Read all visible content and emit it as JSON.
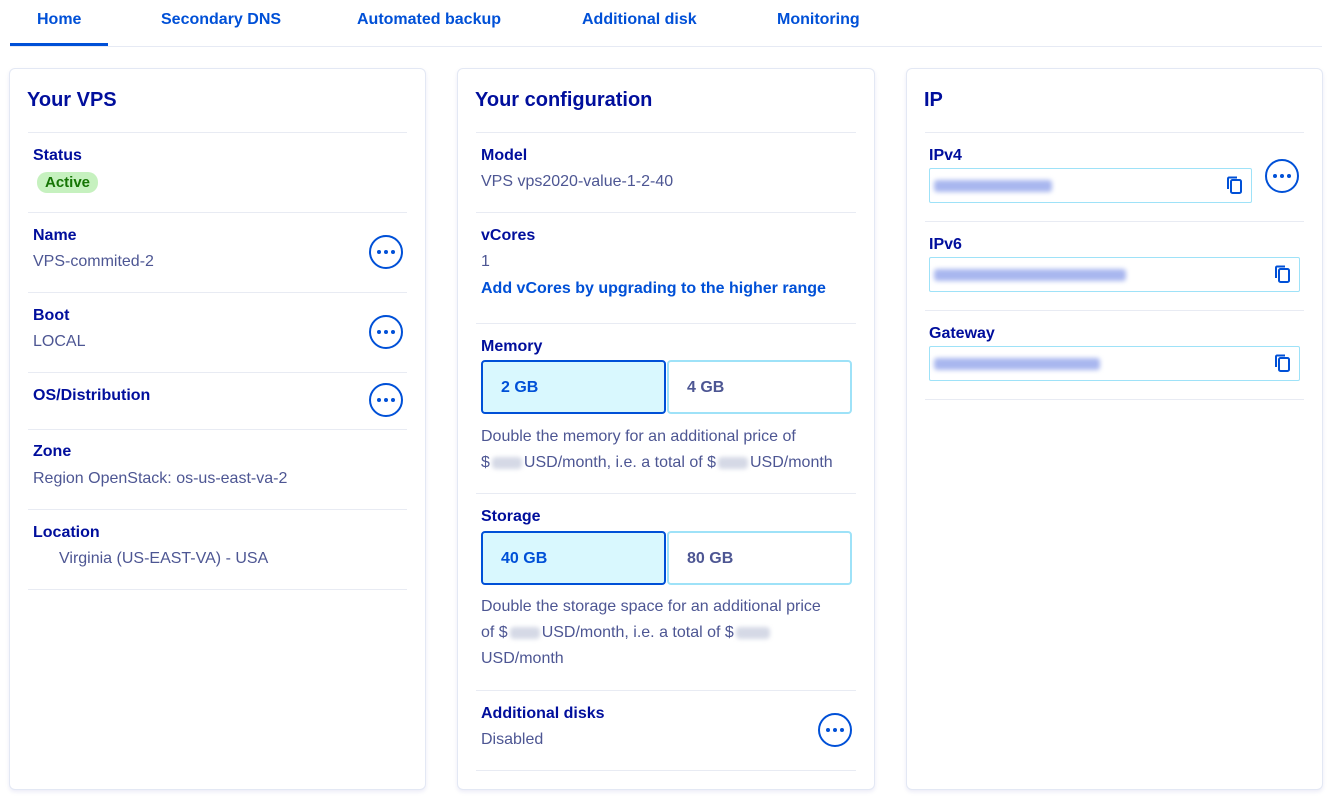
{
  "tabs": [
    {
      "label": "Home",
      "active": true
    },
    {
      "label": "Secondary DNS"
    },
    {
      "label": "Automated backup"
    },
    {
      "label": "Additional disk"
    },
    {
      "label": "Monitoring"
    }
  ],
  "vps": {
    "title": "Your VPS",
    "status_label": "Status",
    "status_value": "Active",
    "name_label": "Name",
    "name_value": "VPS-commited-2",
    "boot_label": "Boot",
    "boot_value": "LOCAL",
    "os_label": "OS/Distribution",
    "zone_label": "Zone",
    "zone_value": "Region OpenStack: os-us-east-va-2",
    "location_label": "Location",
    "location_value": "Virginia (US-EAST-VA) - USA"
  },
  "config": {
    "title": "Your configuration",
    "model_label": "Model",
    "model_value": "VPS vps2020-value-1-2-40",
    "vcores_label": "vCores",
    "vcores_value": "1",
    "vcores_link": "Add vCores by upgrading to the higher range",
    "memory_label": "Memory",
    "memory_options": [
      "2 GB",
      "4 GB"
    ],
    "memory_selected": "2 GB",
    "memory_desc_1a": "Double the memory for an additional price of",
    "memory_desc_2a": "$",
    "memory_desc_2b": "USD/month, i.e. a total of $",
    "memory_desc_2c": "USD/month",
    "storage_label": "Storage",
    "storage_options": [
      "40 GB",
      "80 GB"
    ],
    "storage_selected": "40 GB",
    "storage_desc_1": "Double the storage space for an additional price",
    "storage_desc_2a": "of $",
    "storage_desc_2b": "USD/month, i.e. a total of $",
    "storage_desc_3": "USD/month",
    "disks_label": "Additional disks",
    "disks_value": "Disabled"
  },
  "ip": {
    "title": "IP",
    "ipv4_label": "IPv4",
    "ipv6_label": "IPv6",
    "gateway_label": "Gateway"
  },
  "colors": {
    "primary": "#0050d7",
    "text_dark": "#000e9c",
    "text_muted": "#4d5693",
    "active_badge_bg": "#c6f1bf",
    "active_badge_text": "#167505",
    "selected_tile_bg": "#d9f8fe",
    "tile_border": "#9ee2f8"
  },
  "icons": {
    "more": "more-options-icon",
    "copy": "copy-icon"
  }
}
